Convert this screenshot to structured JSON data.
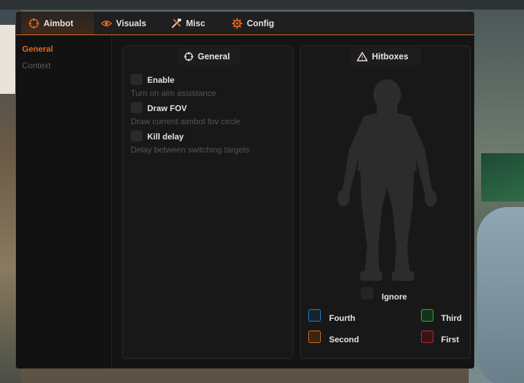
{
  "tabs": [
    {
      "label": "Aimbot",
      "icon": "crosshair-icon",
      "active": true
    },
    {
      "label": "Visuals",
      "icon": "eye-icon",
      "active": false
    },
    {
      "label": "Misc",
      "icon": "tools-icon",
      "active": false
    },
    {
      "label": "Config",
      "icon": "gear-icon",
      "active": false
    }
  ],
  "sidebar": {
    "items": [
      {
        "label": "General",
        "active": true
      },
      {
        "label": "Context",
        "active": false
      }
    ]
  },
  "general_panel": {
    "title": "General",
    "options": [
      {
        "label": "Enable",
        "description": "Turn on aim assistance",
        "checked": false
      },
      {
        "label": "Draw FOV",
        "description": "Draw current aimbot fov circle",
        "checked": false
      },
      {
        "label": "Kill delay",
        "description": "Delay between switching targets",
        "checked": false
      }
    ]
  },
  "hitboxes_panel": {
    "title": "Hitboxes",
    "ignore_label": "Ignore",
    "priorities": [
      {
        "label": "Fourth",
        "color": "#1e88c8"
      },
      {
        "label": "Third",
        "color": "#3fae3a"
      },
      {
        "label": "Second",
        "color": "#d9731f"
      },
      {
        "label": "First",
        "color": "#c42a2a"
      }
    ]
  },
  "colors": {
    "accent": "#e8651c",
    "panel_bg": "#181818",
    "window_bg": "#141414"
  }
}
